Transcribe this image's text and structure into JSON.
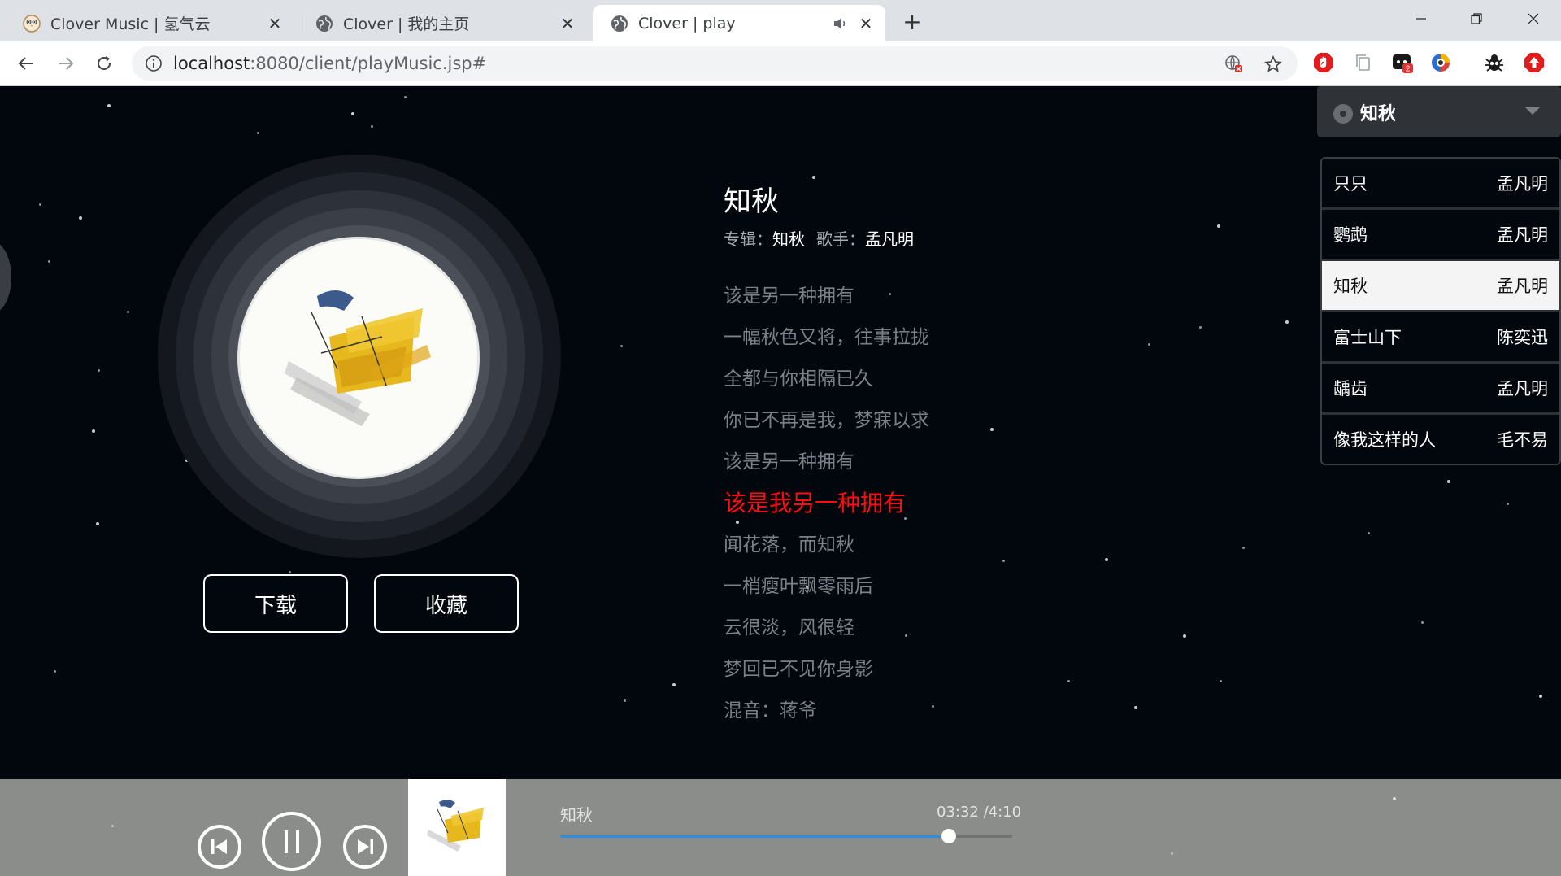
{
  "browser": {
    "tabs": [
      {
        "title": "Clover Music | 氢气云",
        "favicon": "owl-icon"
      },
      {
        "title": "Clover | 我的主页",
        "favicon": "globe-icon"
      },
      {
        "title": "Clover | play",
        "favicon": "globe-icon",
        "audio": true,
        "active": true
      }
    ],
    "url_host": "localhost",
    "url_rest": ":8080/client/playMusic.jsp#",
    "extension_badge": "2"
  },
  "song": {
    "title": "知秋",
    "album_label": "专辑：",
    "album": "知秋",
    "artist_label": "歌手：",
    "artist": "孟凡明"
  },
  "actions": {
    "download": "下载",
    "favorite": "收藏"
  },
  "lyrics": [
    "该是另一种拥有",
    "一幅秋色又将，往事拉拢",
    "全都与你相隔已久",
    "你已不再是我，梦寐以求",
    "该是另一种拥有",
    "该是我另一种拥有",
    "闻花落，而知秋",
    "一梢瘦叶飘零雨后",
    "云很淡，风很轻",
    "梦回已不见你身影",
    "混音：蒋爷"
  ],
  "current_lyric_index": 5,
  "selector": {
    "label": "知秋"
  },
  "playlist": [
    {
      "title": "只只",
      "artist": "孟凡明"
    },
    {
      "title": "鹦鹉",
      "artist": "孟凡明"
    },
    {
      "title": "知秋",
      "artist": "孟凡明",
      "active": true
    },
    {
      "title": "富士山下",
      "artist": "陈奕迅"
    },
    {
      "title": "龋齿",
      "artist": "孟凡明"
    },
    {
      "title": "像我这样的人",
      "artist": "毛不易"
    }
  ],
  "player": {
    "title": "知秋",
    "time": "03:32 /4:10",
    "progress": 0.86
  },
  "colors": {
    "background": "#02060d",
    "current_lyric": "#ff0d0d",
    "progress_fill": "#2a8fe0",
    "player_bar": "#8a8d89"
  }
}
